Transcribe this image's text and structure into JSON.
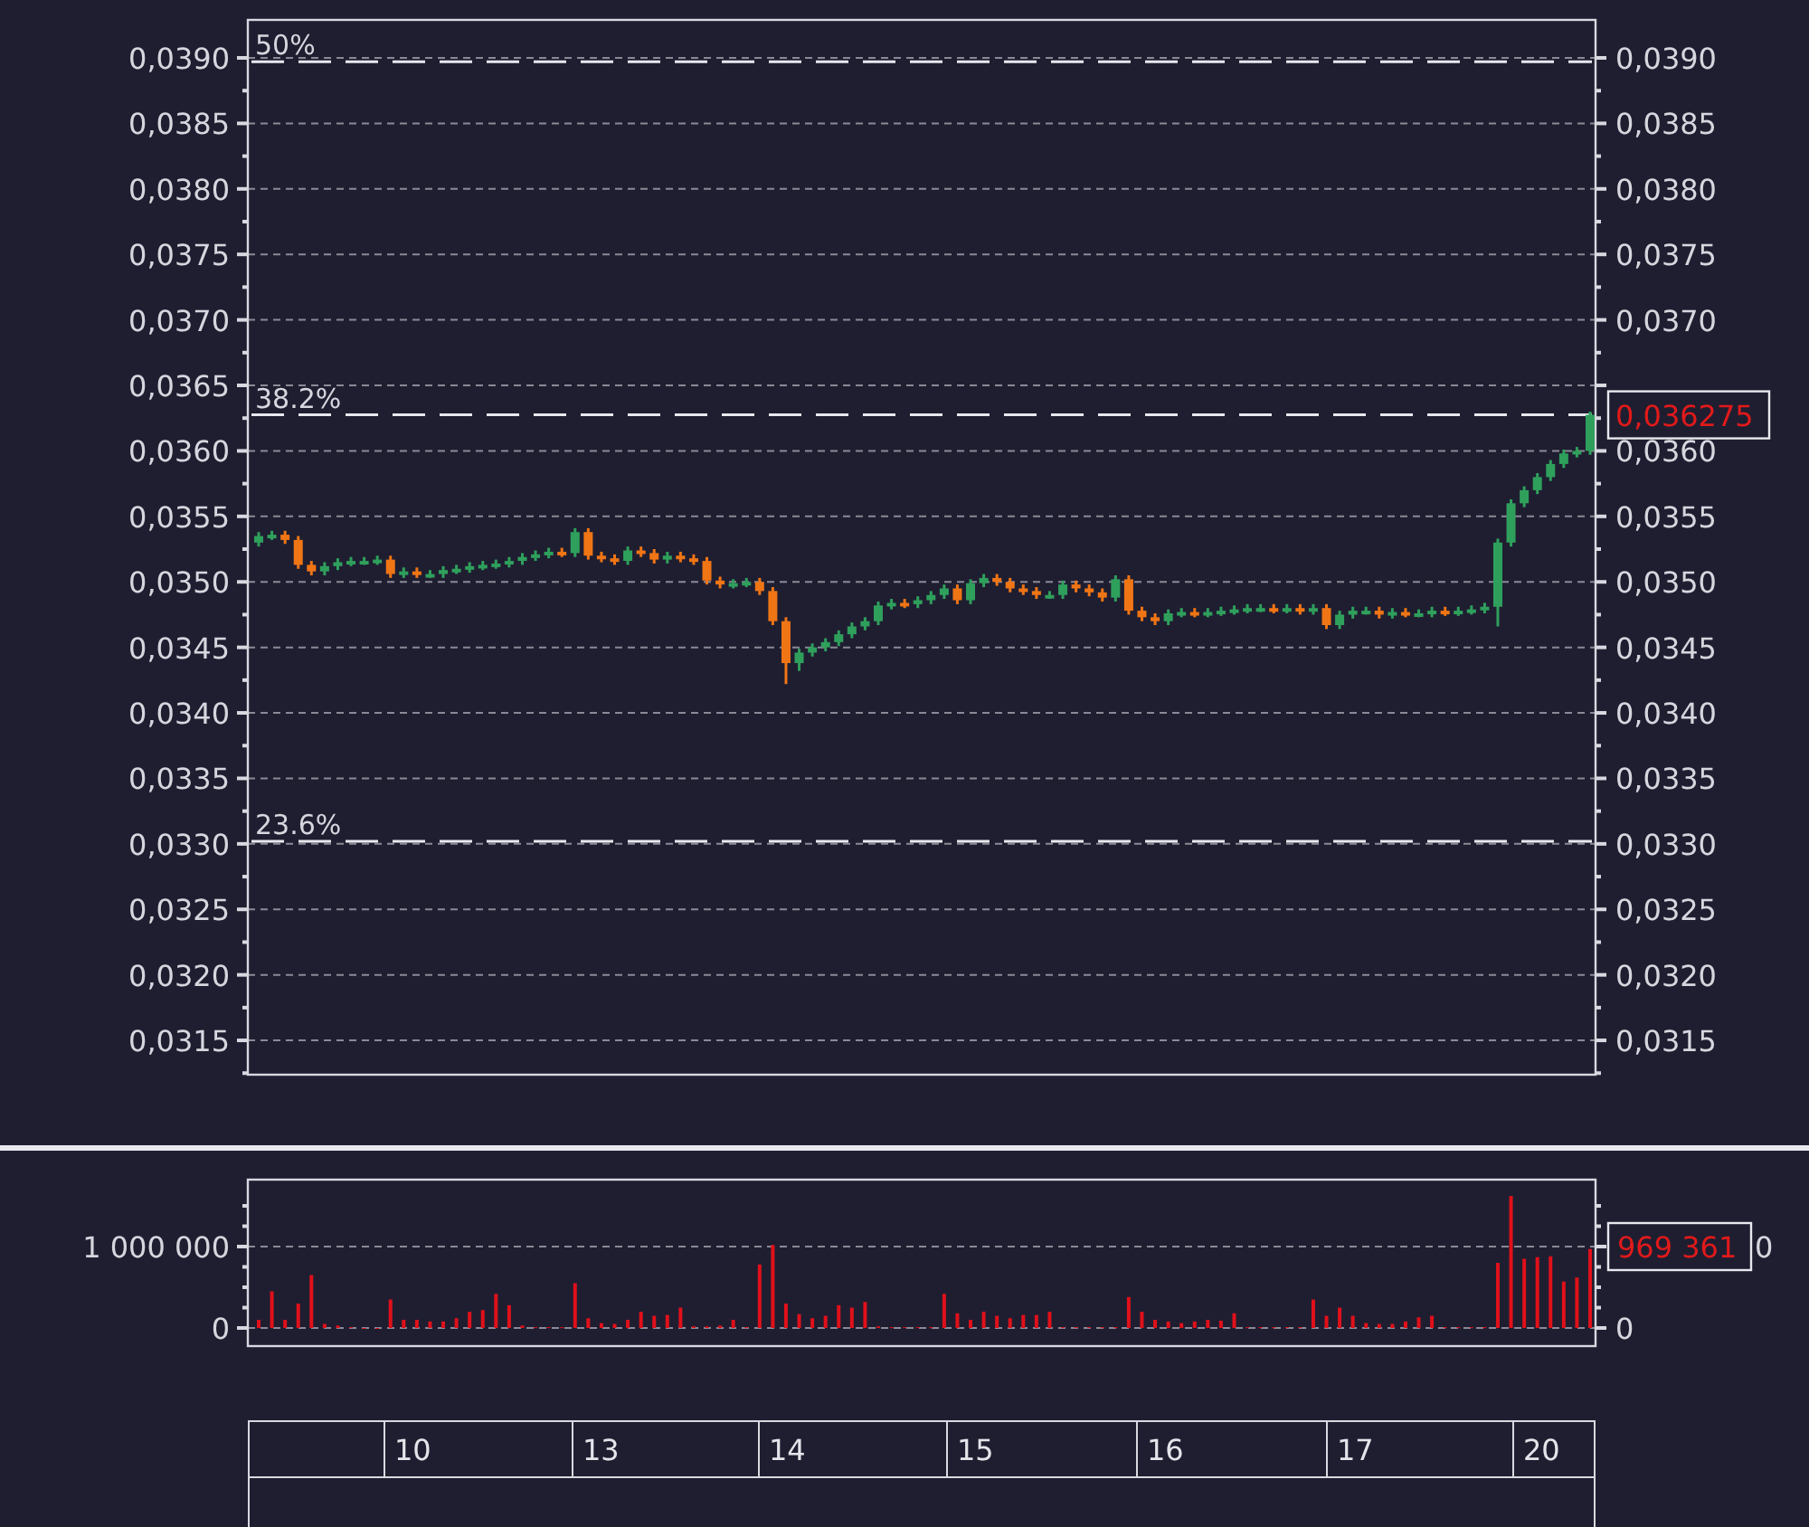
{
  "price_chart": {
    "last_price": "0,036275",
    "fib_labels": [
      "50%",
      "38.2%",
      "23.6%"
    ],
    "chart_data": {
      "type": "candlestick",
      "ylim": [
        0.031238,
        0.03929
      ],
      "y2lim": [
        0.031238,
        0.03929
      ],
      "yticks": [
        {
          "value": 0.039,
          "label": "0,0390"
        },
        {
          "value": 0.0385,
          "label": "0,0385"
        },
        {
          "value": 0.038,
          "label": "0,0380"
        },
        {
          "value": 0.0375,
          "label": "0,0375"
        },
        {
          "value": 0.037,
          "label": "0,0370"
        },
        {
          "value": 0.0365,
          "label": "0,0365"
        },
        {
          "value": 0.036,
          "label": "0,0360"
        },
        {
          "value": 0.0355,
          "label": "0,0355"
        },
        {
          "value": 0.035,
          "label": "0,0350"
        },
        {
          "value": 0.0345,
          "label": "0,0345"
        },
        {
          "value": 0.034,
          "label": "0,0340"
        },
        {
          "value": 0.0335,
          "label": "0,0335"
        },
        {
          "value": 0.033,
          "label": "0,0330"
        },
        {
          "value": 0.0325,
          "label": "0,0325"
        },
        {
          "value": 0.032,
          "label": "0,0320"
        },
        {
          "value": 0.0315,
          "label": "0,0315"
        }
      ],
      "y2ticks": [
        {
          "value": 0.039,
          "label": "0,0390"
        },
        {
          "value": 0.0385,
          "label": "0,0385"
        },
        {
          "value": 0.038,
          "label": "0,0380"
        },
        {
          "value": 0.0375,
          "label": "0,0375"
        },
        {
          "value": 0.037,
          "label": "0,0370"
        },
        {
          "value": 0.036,
          "label": "0,0360"
        },
        {
          "value": 0.0355,
          "label": "0,0355"
        },
        {
          "value": 0.035,
          "label": "0,0350"
        },
        {
          "value": 0.0345,
          "label": "0,0345"
        },
        {
          "value": 0.034,
          "label": "0,0340"
        },
        {
          "value": 0.0335,
          "label": "0,0335"
        },
        {
          "value": 0.033,
          "label": "0,0330"
        },
        {
          "value": 0.0325,
          "label": "0,0325"
        },
        {
          "value": 0.032,
          "label": "0,0320"
        },
        {
          "value": 0.0315,
          "label": "0,0315"
        }
      ],
      "grid": true,
      "ohlc": [
        [
          0.0353,
          0.03538,
          0.03527,
          0.03535
        ],
        [
          0.03535,
          0.03539,
          0.03532,
          0.03536
        ],
        [
          0.03536,
          0.03539,
          0.03529,
          0.03532
        ],
        [
          0.03532,
          0.03535,
          0.0351,
          0.03513
        ],
        [
          0.03513,
          0.03516,
          0.03505,
          0.03508
        ],
        [
          0.03508,
          0.03515,
          0.03505,
          0.03512
        ],
        [
          0.03512,
          0.03518,
          0.03509,
          0.03515
        ],
        [
          0.03515,
          0.03519,
          0.03512,
          0.03516
        ],
        [
          0.03516,
          0.03519,
          0.03513,
          0.03516
        ],
        [
          0.03516,
          0.0352,
          0.03513,
          0.03517
        ],
        [
          0.03517,
          0.0352,
          0.03503,
          0.03506
        ],
        [
          0.03506,
          0.03511,
          0.03503,
          0.03508
        ],
        [
          0.03508,
          0.03511,
          0.03503,
          0.03506
        ],
        [
          0.03506,
          0.03509,
          0.03503,
          0.03506
        ],
        [
          0.03506,
          0.03512,
          0.03503,
          0.03509
        ],
        [
          0.03509,
          0.03513,
          0.03506,
          0.0351
        ],
        [
          0.0351,
          0.03515,
          0.03507,
          0.03512
        ],
        [
          0.03512,
          0.03516,
          0.03509,
          0.03513
        ],
        [
          0.03513,
          0.03517,
          0.0351,
          0.03514
        ],
        [
          0.03514,
          0.03519,
          0.03511,
          0.03516
        ],
        [
          0.03516,
          0.03522,
          0.03513,
          0.03519
        ],
        [
          0.03519,
          0.03524,
          0.03516,
          0.03521
        ],
        [
          0.03521,
          0.03526,
          0.03518,
          0.03523
        ],
        [
          0.03523,
          0.03526,
          0.03519,
          0.03522
        ],
        [
          0.03522,
          0.03541,
          0.03519,
          0.03538
        ],
        [
          0.03538,
          0.03541,
          0.03517,
          0.0352
        ],
        [
          0.0352,
          0.03523,
          0.03515,
          0.03518
        ],
        [
          0.03518,
          0.03521,
          0.03513,
          0.03516
        ],
        [
          0.03516,
          0.03527,
          0.03513,
          0.03524
        ],
        [
          0.03524,
          0.03527,
          0.03519,
          0.03522
        ],
        [
          0.03522,
          0.03525,
          0.03514,
          0.03517
        ],
        [
          0.03517,
          0.03523,
          0.03514,
          0.0352
        ],
        [
          0.0352,
          0.03523,
          0.03515,
          0.03518
        ],
        [
          0.03518,
          0.03521,
          0.03513,
          0.03516
        ],
        [
          0.03516,
          0.03519,
          0.03498,
          0.03501
        ],
        [
          0.03501,
          0.03504,
          0.03495,
          0.03498
        ],
        [
          0.03498,
          0.03502,
          0.03495,
          0.03499
        ],
        [
          0.03499,
          0.03503,
          0.03496,
          0.035
        ],
        [
          0.035,
          0.03503,
          0.0349,
          0.03493
        ],
        [
          0.03493,
          0.03496,
          0.03467,
          0.0347
        ],
        [
          0.0347,
          0.03473,
          0.03422,
          0.03438
        ],
        [
          0.03438,
          0.03449,
          0.03432,
          0.03446
        ],
        [
          0.03446,
          0.03453,
          0.03443,
          0.0345
        ],
        [
          0.0345,
          0.03457,
          0.03447,
          0.03454
        ],
        [
          0.03454,
          0.03463,
          0.03451,
          0.0346
        ],
        [
          0.0346,
          0.03469,
          0.03457,
          0.03466
        ],
        [
          0.03466,
          0.03473,
          0.03463,
          0.0347
        ],
        [
          0.0347,
          0.03485,
          0.03467,
          0.03482
        ],
        [
          0.03482,
          0.03487,
          0.03479,
          0.03484
        ],
        [
          0.03484,
          0.03487,
          0.0348,
          0.03483
        ],
        [
          0.03483,
          0.03489,
          0.0348,
          0.03486
        ],
        [
          0.03486,
          0.03493,
          0.03483,
          0.0349
        ],
        [
          0.0349,
          0.03498,
          0.03487,
          0.03495
        ],
        [
          0.03495,
          0.03498,
          0.03483,
          0.03486
        ],
        [
          0.03486,
          0.03502,
          0.03483,
          0.03499
        ],
        [
          0.03499,
          0.03506,
          0.03496,
          0.03503
        ],
        [
          0.03503,
          0.03506,
          0.03497,
          0.035
        ],
        [
          0.035,
          0.03503,
          0.03492,
          0.03495
        ],
        [
          0.03495,
          0.03498,
          0.0349,
          0.03493
        ],
        [
          0.03493,
          0.03496,
          0.03487,
          0.0349
        ],
        [
          0.0349,
          0.03493,
          0.03487,
          0.0349
        ],
        [
          0.0349,
          0.03501,
          0.03487,
          0.03498
        ],
        [
          0.03498,
          0.03501,
          0.03492,
          0.03495
        ],
        [
          0.03495,
          0.03498,
          0.03489,
          0.03492
        ],
        [
          0.03492,
          0.03495,
          0.03485,
          0.03488
        ],
        [
          0.03488,
          0.03505,
          0.03485,
          0.03502
        ],
        [
          0.03502,
          0.03505,
          0.03475,
          0.03478
        ],
        [
          0.03478,
          0.03481,
          0.0347,
          0.03473
        ],
        [
          0.03473,
          0.03476,
          0.03467,
          0.0347
        ],
        [
          0.0347,
          0.03479,
          0.03467,
          0.03476
        ],
        [
          0.03476,
          0.0348,
          0.03473,
          0.03477
        ],
        [
          0.03477,
          0.0348,
          0.03473,
          0.03476
        ],
        [
          0.03476,
          0.0348,
          0.03473,
          0.03477
        ],
        [
          0.03477,
          0.03481,
          0.03474,
          0.03478
        ],
        [
          0.03478,
          0.03482,
          0.03475,
          0.03479
        ],
        [
          0.03479,
          0.03483,
          0.03476,
          0.0348
        ],
        [
          0.0348,
          0.03483,
          0.03477,
          0.0348
        ],
        [
          0.0348,
          0.03483,
          0.03476,
          0.03479
        ],
        [
          0.03479,
          0.03483,
          0.03476,
          0.0348
        ],
        [
          0.0348,
          0.03483,
          0.03475,
          0.03478
        ],
        [
          0.03478,
          0.03483,
          0.03475,
          0.0348
        ],
        [
          0.0348,
          0.03483,
          0.03464,
          0.03467
        ],
        [
          0.03467,
          0.03478,
          0.03464,
          0.03475
        ],
        [
          0.03475,
          0.03481,
          0.03472,
          0.03478
        ],
        [
          0.03478,
          0.03481,
          0.03475,
          0.03478
        ],
        [
          0.03478,
          0.03481,
          0.03472,
          0.03475
        ],
        [
          0.03475,
          0.0348,
          0.03472,
          0.03477
        ],
        [
          0.03477,
          0.0348,
          0.03473,
          0.03476
        ],
        [
          0.03476,
          0.03479,
          0.03473,
          0.03476
        ],
        [
          0.03476,
          0.03481,
          0.03473,
          0.03478
        ],
        [
          0.03478,
          0.03481,
          0.03474,
          0.03477
        ],
        [
          0.03477,
          0.03481,
          0.03474,
          0.03478
        ],
        [
          0.03478,
          0.03482,
          0.03475,
          0.03479
        ],
        [
          0.03479,
          0.03484,
          0.03476,
          0.03481
        ],
        [
          0.03481,
          0.03533,
          0.03466,
          0.0353
        ],
        [
          0.0353,
          0.03563,
          0.03527,
          0.0356
        ],
        [
          0.0356,
          0.03573,
          0.03557,
          0.0357
        ],
        [
          0.0357,
          0.03583,
          0.03567,
          0.0358
        ],
        [
          0.0358,
          0.03593,
          0.03577,
          0.0359
        ],
        [
          0.0359,
          0.03601,
          0.03587,
          0.03598
        ],
        [
          0.03598,
          0.03603,
          0.03595,
          0.036
        ],
        [
          0.036,
          0.0363,
          0.03597,
          0.036275
        ]
      ]
    }
  },
  "volume_chart": {
    "last_volume": "969 361",
    "right_labels": [
      "0",
      "0"
    ],
    "chart_data": {
      "type": "bar",
      "grid": true,
      "ylim": [
        -222000,
        1822000
      ],
      "yticks": [
        {
          "value": 0,
          "label": "0"
        },
        {
          "value": 1000000,
          "label": "1 000 000"
        }
      ],
      "series": [
        {
          "color": "#e0101a",
          "values": [
            100000,
            450000,
            100000,
            300000,
            650000,
            50000,
            30000,
            10000,
            0,
            0,
            350000,
            100000,
            100000,
            80000,
            80000,
            120000,
            200000,
            220000,
            420000,
            280000,
            30000,
            10000,
            10000,
            10000,
            550000,
            120000,
            60000,
            50000,
            100000,
            200000,
            150000,
            160000,
            250000,
            20000,
            20000,
            30000,
            100000,
            10000,
            780000,
            1020000,
            300000,
            170000,
            120000,
            150000,
            280000,
            250000,
            320000,
            20000,
            10000,
            10000,
            10000,
            10000,
            420000,
            180000,
            100000,
            200000,
            150000,
            120000,
            160000,
            160000,
            200000,
            10000,
            10000,
            10000,
            10000,
            10000,
            380000,
            200000,
            100000,
            80000,
            60000,
            80000,
            100000,
            90000,
            180000,
            10000,
            10000,
            10000,
            10000,
            10000,
            350000,
            150000,
            250000,
            150000,
            60000,
            50000,
            50000,
            80000,
            130000,
            150000,
            10000,
            10000,
            10000,
            10000,
            800000,
            1620000,
            850000,
            870000,
            880000,
            570000,
            620000,
            970000
          ]
        }
      ]
    }
  },
  "time_axis": {
    "days": [
      "10",
      "13",
      "14",
      "15",
      "16",
      "17",
      "20"
    ]
  }
}
